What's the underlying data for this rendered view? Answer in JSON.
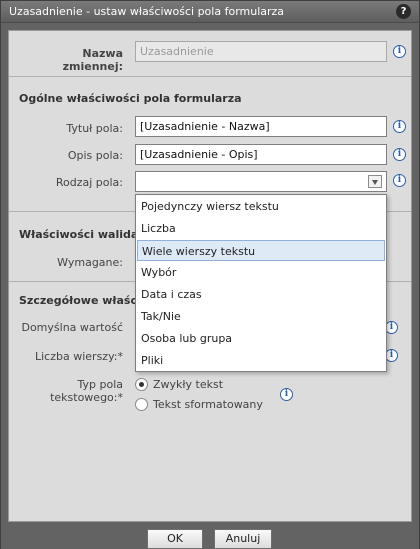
{
  "window": {
    "title": "Uzasadnienie - ustaw właściwości pola formularza",
    "help_label": "?"
  },
  "variable": {
    "label": "Nazwa zmiennej:",
    "value": "Uzasadnienie"
  },
  "general": {
    "heading": "Ogólne właściwości pola formularza",
    "field_title_label": "Tytuł pola:",
    "field_title_value": "[Uzasadnienie - Nazwa]",
    "description_label": "Opis pola:",
    "description_value": "[Uzasadnienie - Opis]",
    "type_label": "Rodzaj pola:",
    "type_value": ""
  },
  "dropdown": {
    "options": [
      "Pojedynczy wiersz tekstu",
      "Liczba",
      "Wiele wierszy tekstu",
      "Wybór",
      "Data i czas",
      "Tak/Nie",
      "Osoba lub grupa",
      "Pliki"
    ],
    "highlighted": "Wiele wierszy tekstu"
  },
  "validation": {
    "heading": "Właściwości walidacji",
    "required_label": "Wymagane:"
  },
  "details": {
    "heading": "Szczegółowe właściwo",
    "default_label": "Domyślna wartość",
    "rows_label": "Liczba wierszy:*",
    "text_type_label_line1": "Typ pola",
    "text_type_label_line2": "tekstowego:*",
    "radio_plain": "Zwykły tekst",
    "radio_formatted": "Tekst sformatowany"
  },
  "buttons": {
    "ok": "OK",
    "cancel": "Anuluj"
  },
  "info_icon_glyph": "i"
}
